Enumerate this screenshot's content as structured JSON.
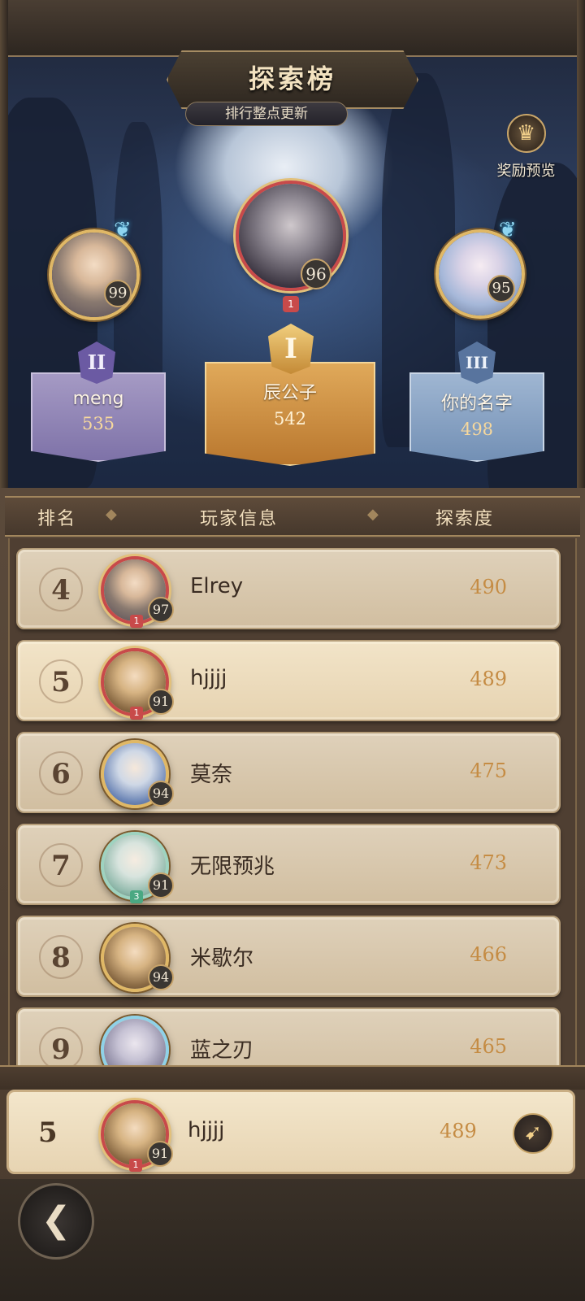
{
  "header": {
    "title": "探索榜",
    "subtitle": "排行整点更新",
    "reward_label": "奖励预览"
  },
  "podium": {
    "first": {
      "rank": "I",
      "rank_tag": "1",
      "name": "辰公子",
      "score": "542",
      "level": "96"
    },
    "second": {
      "rank": "II",
      "name": "meng",
      "score": "535",
      "level": "99"
    },
    "third": {
      "rank": "III",
      "name": "你的名字",
      "score": "498",
      "level": "95"
    }
  },
  "columns": {
    "rank": "排名",
    "player": "玩家信息",
    "score": "探索度"
  },
  "rows": [
    {
      "rank": "4",
      "name": "Elrey",
      "score": "490",
      "level": "97",
      "tag": "1"
    },
    {
      "rank": "5",
      "name": "hjjjj",
      "score": "489",
      "level": "91",
      "tag": "1"
    },
    {
      "rank": "6",
      "name": "莫奈",
      "score": "475",
      "level": "94"
    },
    {
      "rank": "7",
      "name": "无限预兆",
      "score": "473",
      "level": "91",
      "tag": "3"
    },
    {
      "rank": "8",
      "name": "米歇尔",
      "score": "466",
      "level": "94"
    },
    {
      "rank": "9",
      "name": "蓝之刃",
      "score": "465"
    }
  ],
  "my_entry": {
    "rank": "5",
    "name": "hjjjj",
    "score": "489",
    "level": "91",
    "tag": "1"
  },
  "icons": {
    "reward": "treasure-chest-icon",
    "locate": "locate-arrow-icon",
    "back": "back-arrow-icon"
  },
  "colors": {
    "score": "#c58c44",
    "gold": "#e0b866",
    "silver": "#8a7fb8",
    "bronze": "#8aa6c8"
  }
}
